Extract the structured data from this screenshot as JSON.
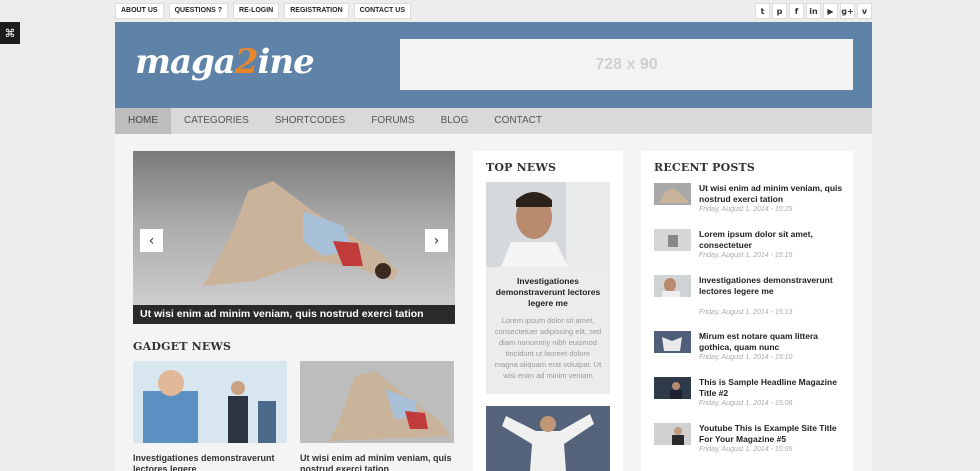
{
  "sidebar_toggle": {
    "icon": "expand-icon",
    "glyph": "⌘"
  },
  "topbar": {
    "links": [
      "ABOUT US",
      "QUESTIONS ?",
      "RE-LOGIN",
      "REGISTRATION",
      "CONTACT US"
    ],
    "social": [
      {
        "icon": "twitter-icon",
        "glyph": "t"
      },
      {
        "icon": "pinterest-icon",
        "glyph": "p"
      },
      {
        "icon": "facebook-icon",
        "glyph": "f"
      },
      {
        "icon": "linkedin-icon",
        "glyph": "in"
      },
      {
        "icon": "youtube-icon",
        "glyph": "▶"
      },
      {
        "icon": "googleplus-icon",
        "glyph": "g+"
      },
      {
        "icon": "vimeo-icon",
        "glyph": "v"
      }
    ]
  },
  "header": {
    "logo_pre": "maga",
    "logo_num": "2",
    "logo_post": "ine",
    "ad_text": "728 x 90",
    "bg_color": "#5f82a8",
    "accent": "#e8872a"
  },
  "nav": {
    "items": [
      "HOME",
      "CATEGORIES",
      "SHORTCODES",
      "FORUMS",
      "BLOG",
      "CONTACT"
    ],
    "active": "HOME"
  },
  "slider": {
    "caption": "Ut wisi enim ad minim veniam, quis nostrud exerci tation",
    "prev": "‹",
    "next": "›"
  },
  "gadget_news": {
    "title": "GADGET NEWS",
    "items": [
      {
        "title": "Investigationes demonstraverunt lectores legere"
      },
      {
        "title": "Ut wisi enim ad minim veniam, quis nostrud exerci tation"
      }
    ]
  },
  "top_news": {
    "title": "TOP NEWS",
    "card_title": "Investigationes demonstraverunt lectores legere me",
    "card_text": "Lorem ipsum dolor sit amet, consectetuer adipiscing elit, sed diam nonummy nibh euismod tincidunt ut laoreet dolore magna aliquam erat volutpat. Ut wisi enim ad minim veniam"
  },
  "recent_posts": {
    "title": "RECENT POSTS",
    "items": [
      {
        "title": "Ut wisi enim ad minim veniam, quis nostrud exerci tation",
        "date": "Friday, August 1, 2014 - 15:25"
      },
      {
        "title": "Lorem ipsum dolor sit amet, consectetuer",
        "date": "Friday, August 1, 2014 - 15:15"
      },
      {
        "title": "Investigationes demonstraverunt lectores legere me",
        "date": "Friday, August 1, 2014 - 15:13"
      },
      {
        "title": "Mirum est notare quam littera gothica, quam nunc",
        "date": "Friday, August 1, 2014 - 15:10"
      },
      {
        "title": "This is Sample Headline Magazine Title #2",
        "date": "Friday, August 1, 2014 - 15:08"
      },
      {
        "title": "Youtube This is Example Site Title For Your Magazine #5",
        "date": "Friday, August 1, 2014 - 15:05"
      }
    ]
  }
}
